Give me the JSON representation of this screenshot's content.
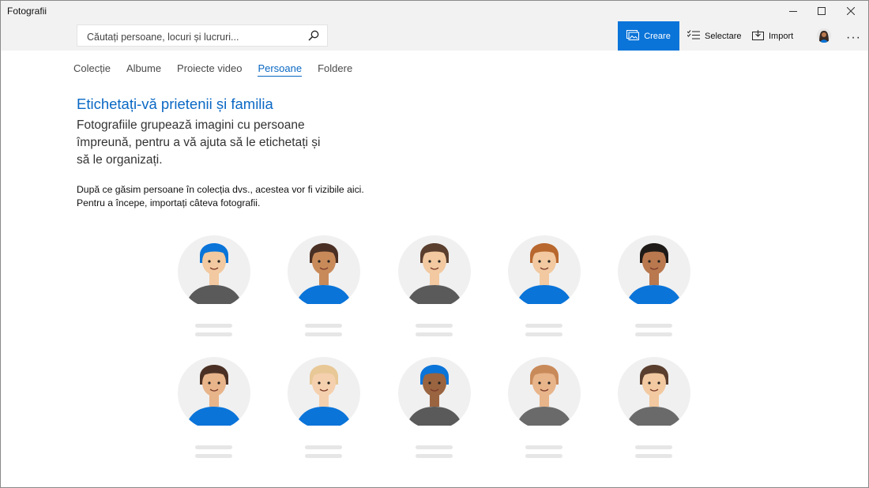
{
  "app": {
    "title": "Fotografii"
  },
  "window_controls": {
    "minimize_icon": "minimize-icon",
    "maximize_icon": "maximize-icon",
    "close_icon": "close-icon"
  },
  "search": {
    "placeholder": "Căutați persoane, locuri și lucruri...",
    "value": "",
    "icon": "search-icon"
  },
  "toolbar": {
    "create_label": "Creare",
    "select_label": "Selectare",
    "import_label": "Import",
    "more_label": "···"
  },
  "tabs": [
    {
      "label": "Colecție",
      "active": false
    },
    {
      "label": "Albume",
      "active": false
    },
    {
      "label": "Proiecte video",
      "active": false
    },
    {
      "label": "Persoane",
      "active": true
    },
    {
      "label": "Foldere",
      "active": false
    }
  ],
  "content": {
    "heading": "Etichetați-vă prietenii și familia",
    "description": "Fotografiile grupează imagini cu persoane împreună, pentru a vă ajuta să le etichetați și să le organizați.",
    "note_line1": "După ce găsim persoane în colecția dvs., acestea vor fi vizibile aici.",
    "note_line2": "Pentru a începe, importați câteva fotografii."
  },
  "colors": {
    "accent": "#0a74d9",
    "link": "#0a68c4",
    "placeholder_bar": "#e6e6e6",
    "circle": "#f0f0f0"
  },
  "people": [
    {
      "name": "person-1",
      "skin": "#f2c9a0",
      "hair": "#0a74d9",
      "shirt": "#5a5a5a"
    },
    {
      "name": "person-2",
      "skin": "#c98a5a",
      "hair": "#4a3024",
      "shirt": "#0a74d9"
    },
    {
      "name": "person-3",
      "skin": "#f2c9a0",
      "hair": "#5a3e2e",
      "shirt": "#5a5a5a"
    },
    {
      "name": "person-4",
      "skin": "#f2c9a0",
      "hair": "#b8672e",
      "shirt": "#0a74d9"
    },
    {
      "name": "person-5",
      "skin": "#b9784e",
      "hair": "#1e1a18",
      "shirt": "#0a74d9"
    },
    {
      "name": "person-6",
      "skin": "#e8b48a",
      "hair": "#4a3024",
      "shirt": "#0a74d9"
    },
    {
      "name": "person-7",
      "skin": "#f5d0ae",
      "hair": "#e8c896",
      "shirt": "#0a74d9"
    },
    {
      "name": "person-8",
      "skin": "#9a6440",
      "hair": "#0a74d9",
      "shirt": "#5a5a5a"
    },
    {
      "name": "person-9",
      "skin": "#e8b48a",
      "hair": "#c98a5a",
      "shirt": "#6a6a6a"
    },
    {
      "name": "person-10",
      "skin": "#f2c9a0",
      "hair": "#5a3e2e",
      "shirt": "#6a6a6a"
    }
  ]
}
